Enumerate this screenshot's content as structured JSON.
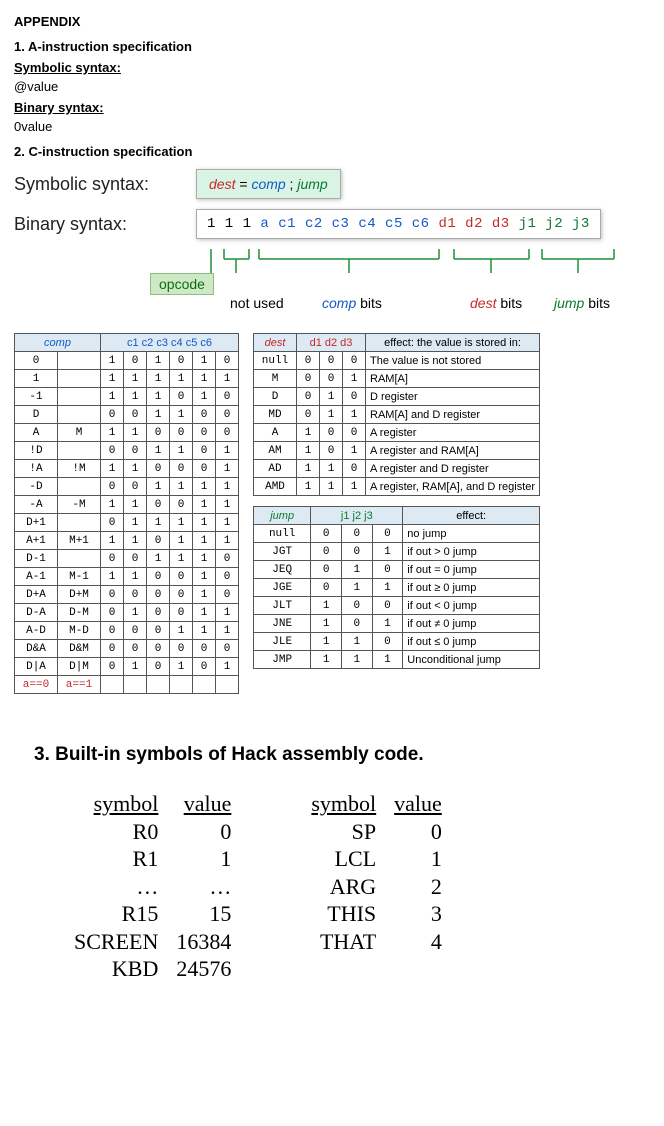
{
  "title": "APPENDIX",
  "sec1": {
    "heading": "1. A-instruction specification",
    "sym_label": "Symbolic syntax:",
    "sym_body": "@value",
    "bin_label": "Binary syntax:",
    "bin_body": "0value"
  },
  "sec2": {
    "heading": "2. C-instruction specification",
    "sym_label": "Symbolic syntax:",
    "sym_formula": {
      "dest": "dest",
      "eq": " = ",
      "comp": "comp",
      "sep": " ; ",
      "jump": "jump"
    },
    "bin_label": "Binary syntax:",
    "bin_formula": {
      "pre": "1 1 1 ",
      "a": "a ",
      "c": "c1 c2 c3 c4 c5 c6 ",
      "d": "d1 d2 d3 ",
      "j": "j1 j2 j3"
    },
    "bracket_labels": {
      "opcode": "opcode",
      "notused": "not used",
      "comp": "comp",
      "compbits": " bits",
      "dest": "dest",
      "destbits": " bits",
      "jump": "jump",
      "jumpbits": " bits"
    }
  },
  "chart_data": {
    "type": "table",
    "comp_table": {
      "headers": [
        "comp",
        "",
        "c1 c2 c3 c4 c5 c6"
      ],
      "rows": [
        {
          "a0": "0",
          "a1": "",
          "bits": [
            "1",
            "0",
            "1",
            "0",
            "1",
            "0"
          ]
        },
        {
          "a0": "1",
          "a1": "",
          "bits": [
            "1",
            "1",
            "1",
            "1",
            "1",
            "1"
          ]
        },
        {
          "a0": "-1",
          "a1": "",
          "bits": [
            "1",
            "1",
            "1",
            "0",
            "1",
            "0"
          ]
        },
        {
          "a0": "D",
          "a1": "",
          "bits": [
            "0",
            "0",
            "1",
            "1",
            "0",
            "0"
          ]
        },
        {
          "a0": "A",
          "a1": "M",
          "bits": [
            "1",
            "1",
            "0",
            "0",
            "0",
            "0"
          ]
        },
        {
          "a0": "!D",
          "a1": "",
          "bits": [
            "0",
            "0",
            "1",
            "1",
            "0",
            "1"
          ]
        },
        {
          "a0": "!A",
          "a1": "!M",
          "bits": [
            "1",
            "1",
            "0",
            "0",
            "0",
            "1"
          ]
        },
        {
          "a0": "-D",
          "a1": "",
          "bits": [
            "0",
            "0",
            "1",
            "1",
            "1",
            "1"
          ]
        },
        {
          "a0": "-A",
          "a1": "-M",
          "bits": [
            "1",
            "1",
            "0",
            "0",
            "1",
            "1"
          ]
        },
        {
          "a0": "D+1",
          "a1": "",
          "bits": [
            "0",
            "1",
            "1",
            "1",
            "1",
            "1"
          ]
        },
        {
          "a0": "A+1",
          "a1": "M+1",
          "bits": [
            "1",
            "1",
            "0",
            "1",
            "1",
            "1"
          ]
        },
        {
          "a0": "D-1",
          "a1": "",
          "bits": [
            "0",
            "0",
            "1",
            "1",
            "1",
            "0"
          ]
        },
        {
          "a0": "A-1",
          "a1": "M-1",
          "bits": [
            "1",
            "1",
            "0",
            "0",
            "1",
            "0"
          ]
        },
        {
          "a0": "D+A",
          "a1": "D+M",
          "bits": [
            "0",
            "0",
            "0",
            "0",
            "1",
            "0"
          ]
        },
        {
          "a0": "D-A",
          "a1": "D-M",
          "bits": [
            "0",
            "1",
            "0",
            "0",
            "1",
            "1"
          ]
        },
        {
          "a0": "A-D",
          "a1": "M-D",
          "bits": [
            "0",
            "0",
            "0",
            "1",
            "1",
            "1"
          ]
        },
        {
          "a0": "D&A",
          "a1": "D&M",
          "bits": [
            "0",
            "0",
            "0",
            "0",
            "0",
            "0"
          ]
        },
        {
          "a0": "D|A",
          "a1": "D|M",
          "bits": [
            "0",
            "1",
            "0",
            "1",
            "0",
            "1"
          ]
        }
      ],
      "footer": {
        "a0": "a==0",
        "a1": "a==1",
        "bits": [
          "",
          "",
          "",
          "",
          "",
          ""
        ]
      }
    },
    "dest_table": {
      "headers": [
        "dest",
        "d1 d2 d3",
        "effect: the value is stored in:"
      ],
      "rows": [
        {
          "m": "null",
          "b": [
            "0",
            "0",
            "0"
          ],
          "e": "The value is not stored"
        },
        {
          "m": "M",
          "b": [
            "0",
            "0",
            "1"
          ],
          "e": "RAM[A]"
        },
        {
          "m": "D",
          "b": [
            "0",
            "1",
            "0"
          ],
          "e": "D register"
        },
        {
          "m": "MD",
          "b": [
            "0",
            "1",
            "1"
          ],
          "e": "RAM[A] and D register"
        },
        {
          "m": "A",
          "b": [
            "1",
            "0",
            "0"
          ],
          "e": "A register"
        },
        {
          "m": "AM",
          "b": [
            "1",
            "0",
            "1"
          ],
          "e": "A register and RAM[A]"
        },
        {
          "m": "AD",
          "b": [
            "1",
            "1",
            "0"
          ],
          "e": "A register and D register"
        },
        {
          "m": "AMD",
          "b": [
            "1",
            "1",
            "1"
          ],
          "e": "A register, RAM[A], and D register"
        }
      ]
    },
    "jump_table": {
      "headers": [
        "jump",
        "j1 j2 j3",
        "effect:"
      ],
      "rows": [
        {
          "m": "null",
          "b": [
            "0",
            "0",
            "0"
          ],
          "e": "no jump"
        },
        {
          "m": "JGT",
          "b": [
            "0",
            "0",
            "1"
          ],
          "e": "if out > 0 jump"
        },
        {
          "m": "JEQ",
          "b": [
            "0",
            "1",
            "0"
          ],
          "e": "if out = 0 jump"
        },
        {
          "m": "JGE",
          "b": [
            "0",
            "1",
            "1"
          ],
          "e": "if out ≥ 0 jump"
        },
        {
          "m": "JLT",
          "b": [
            "1",
            "0",
            "0"
          ],
          "e": "if out < 0 jump"
        },
        {
          "m": "JNE",
          "b": [
            "1",
            "0",
            "1"
          ],
          "e": "if out ≠ 0 jump"
        },
        {
          "m": "JLE",
          "b": [
            "1",
            "1",
            "0"
          ],
          "e": "if out ≤ 0 jump"
        },
        {
          "m": "JMP",
          "b": [
            "1",
            "1",
            "1"
          ],
          "e": "Unconditional jump"
        }
      ]
    }
  },
  "sec3": {
    "heading": "3. Built-in symbols of Hack assembly code.",
    "left": {
      "hdr_sym": "symbol",
      "hdr_val": "value",
      "rows": [
        {
          "s": "R0",
          "v": "0"
        },
        {
          "s": "R1",
          "v": "1"
        },
        {
          "s": "…",
          "v": "…"
        },
        {
          "s": "R15",
          "v": "15"
        },
        {
          "s": "SCREEN",
          "v": "16384"
        },
        {
          "s": "KBD",
          "v": "24576"
        }
      ]
    },
    "right": {
      "hdr_sym": "symbol",
      "hdr_val": "value",
      "rows": [
        {
          "s": "SP",
          "v": "0"
        },
        {
          "s": "LCL",
          "v": "1"
        },
        {
          "s": "ARG",
          "v": "2"
        },
        {
          "s": "THIS",
          "v": "3"
        },
        {
          "s": "THAT",
          "v": "4"
        }
      ]
    }
  }
}
